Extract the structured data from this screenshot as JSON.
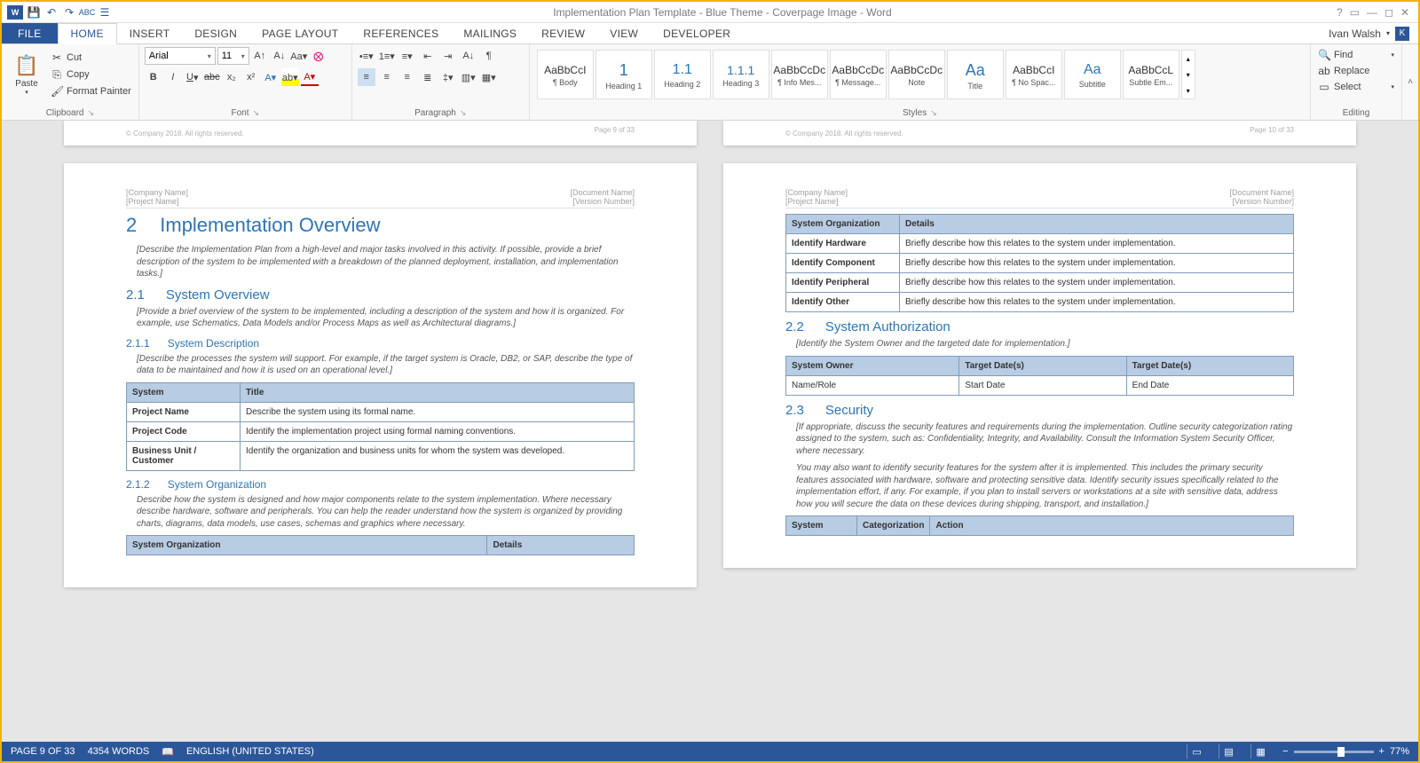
{
  "titlebar": {
    "title": "Implementation Plan Template - Blue Theme - Coverpage Image - Word"
  },
  "ribbon": {
    "tabs": [
      "FILE",
      "HOME",
      "INSERT",
      "DESIGN",
      "PAGE LAYOUT",
      "REFERENCES",
      "MAILINGS",
      "REVIEW",
      "VIEW",
      "DEVELOPER"
    ],
    "user": "Ivan Walsh",
    "user_initial": "K",
    "clipboard": {
      "paste": "Paste",
      "cut": "Cut",
      "copy": "Copy",
      "format_painter": "Format Painter",
      "label": "Clipboard"
    },
    "font": {
      "name": "Arial",
      "size": "11",
      "label": "Font"
    },
    "paragraph": {
      "label": "Paragraph"
    },
    "styles": {
      "label": "Styles",
      "items": [
        {
          "preview": "AaBbCcI",
          "name": "¶ Body",
          "cls": ""
        },
        {
          "preview": "1",
          "name": "Heading 1",
          "cls": "h1"
        },
        {
          "preview": "1.1",
          "name": "Heading 2",
          "cls": "h2"
        },
        {
          "preview": "1.1.1",
          "name": "Heading 3",
          "cls": "h3"
        },
        {
          "preview": "AaBbCcDc",
          "name": "¶ Info Mes...",
          "cls": ""
        },
        {
          "preview": "AaBbCcDc",
          "name": "¶ Message...",
          "cls": ""
        },
        {
          "preview": "AaBbCcDc",
          "name": "Note",
          "cls": ""
        },
        {
          "preview": "",
          "name": "Title",
          "cls": "h1"
        },
        {
          "preview": "AaBbCcI",
          "name": "¶ No Spac...",
          "cls": ""
        },
        {
          "preview": "",
          "name": "Subtitle",
          "cls": "h2"
        },
        {
          "preview": "AaBbCcL",
          "name": "Subtle Em...",
          "cls": ""
        }
      ]
    },
    "editing": {
      "find": "Find",
      "replace": "Replace",
      "select": "Select",
      "label": "Editing"
    }
  },
  "docmeta": {
    "company": "[Company Name]",
    "project": "[Project Name]",
    "docname": "[Document Name]",
    "version": "[Version Number]",
    "copyright": "© Company 2018. All rights reserved.",
    "page9": "Page 9 of 33",
    "page10": "Page 10 of 33"
  },
  "content": {
    "h_2": {
      "num": "2",
      "title": "Implementation Overview"
    },
    "p_2": "[Describe the Implementation Plan from a high-level and major tasks involved in this activity. If possible, provide a brief description of the system to be implemented with a breakdown of the planned deployment, installation, and implementation tasks.]",
    "h_21": {
      "num": "2.1",
      "title": "System Overview"
    },
    "p_21": "[Provide a brief overview of the system to be implemented, including a description of the system and how it is organized. For example, use Schematics, Data Models and/or Process Maps as well as Architectural diagrams.]",
    "h_211": {
      "num": "2.1.1",
      "title": "System Description"
    },
    "p_211": "[Describe the processes the system will support. For example, if the target system is Oracle, DB2, or SAP, describe the type of data to be maintained and how it is used on an operational level.]",
    "tbl_sys": {
      "head": [
        "System",
        "Title"
      ],
      "rows": [
        [
          "Project Name",
          "Describe the system using its formal name."
        ],
        [
          "Project Code",
          "Identify the implementation project using formal naming conventions."
        ],
        [
          "Business Unit / Customer",
          "Identify the organization and business units for whom the system was developed."
        ]
      ]
    },
    "h_212": {
      "num": "2.1.2",
      "title": "System Organization"
    },
    "p_212": "Describe how the system is designed and how major components relate to the system implementation. Where necessary describe hardware, software and peripherals. You can help the reader understand how the system is organized by providing charts, diagrams, data models, use cases, schemas and graphics where necessary.",
    "tbl_org_head": [
      "System Organization",
      "Details"
    ],
    "tbl_org": {
      "head": [
        "System Organization",
        "Details"
      ],
      "rows": [
        [
          "Identify Hardware",
          "Briefly describe how this relates to the system under implementation."
        ],
        [
          "Identify Component",
          "Briefly describe how this relates to the system under implementation."
        ],
        [
          "Identify Peripheral",
          "Briefly describe how this relates to the system under implementation."
        ],
        [
          "Identify Other",
          "Briefly describe how this relates to the system under implementation."
        ]
      ]
    },
    "h_22": {
      "num": "2.2",
      "title": "System Authorization"
    },
    "p_22": "[Identify the System Owner and the targeted date for implementation.]",
    "tbl_auth": {
      "head": [
        "System Owner",
        "Target Date(s)",
        "Target Date(s)"
      ],
      "rows": [
        [
          "Name/Role",
          "Start Date",
          "End Date"
        ]
      ]
    },
    "h_23": {
      "num": "2.3",
      "title": "Security"
    },
    "p_23a": "[If appropriate, discuss the security features and requirements during the implementation. Outline security categorization rating assigned to the system, such as: Confidentiality, Integrity, and Availability. Consult the Information System Security Officer, where necessary.",
    "p_23b": "You may also want to identify security features for the system after it is implemented. This includes the primary security features associated with hardware, software and protecting sensitive data. Identify security issues specifically related to the implementation effort, if any. For example, if you plan to install servers or workstations at a site with sensitive data, address how you will secure the data on these devices during shipping, transport, and installation.]",
    "tbl_sec_head": [
      "System",
      "Categorization",
      "Action"
    ]
  },
  "status": {
    "page": "PAGE 9 OF 33",
    "words": "4354 WORDS",
    "lang": "ENGLISH (UNITED STATES)",
    "zoom": "77%"
  }
}
